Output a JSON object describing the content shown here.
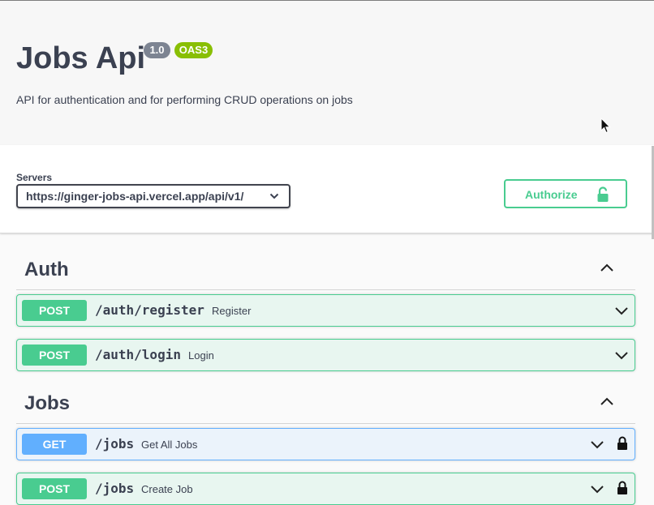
{
  "info": {
    "title": "Jobs Api",
    "version": "1.0",
    "oas": "OAS3",
    "description": "API for authentication and for performing CRUD operations on jobs"
  },
  "servers": {
    "label": "Servers",
    "selected": "https://ginger-jobs-api.vercel.app/api/v1/"
  },
  "authorize": {
    "label": "Authorize"
  },
  "tags": [
    {
      "name": "Auth",
      "operations": [
        {
          "method": "POST",
          "path": "/auth/register",
          "summary": "Register"
        },
        {
          "method": "POST",
          "path": "/auth/login",
          "summary": "Login"
        }
      ]
    },
    {
      "name": "Jobs",
      "operations": [
        {
          "method": "GET",
          "path": "/jobs",
          "summary": "Get All Jobs"
        },
        {
          "method": "POST",
          "path": "/jobs",
          "summary": "Create Job"
        }
      ]
    }
  ],
  "colors": {
    "post": "#49cc90",
    "get": "#61affe",
    "text": "#3b4151"
  }
}
